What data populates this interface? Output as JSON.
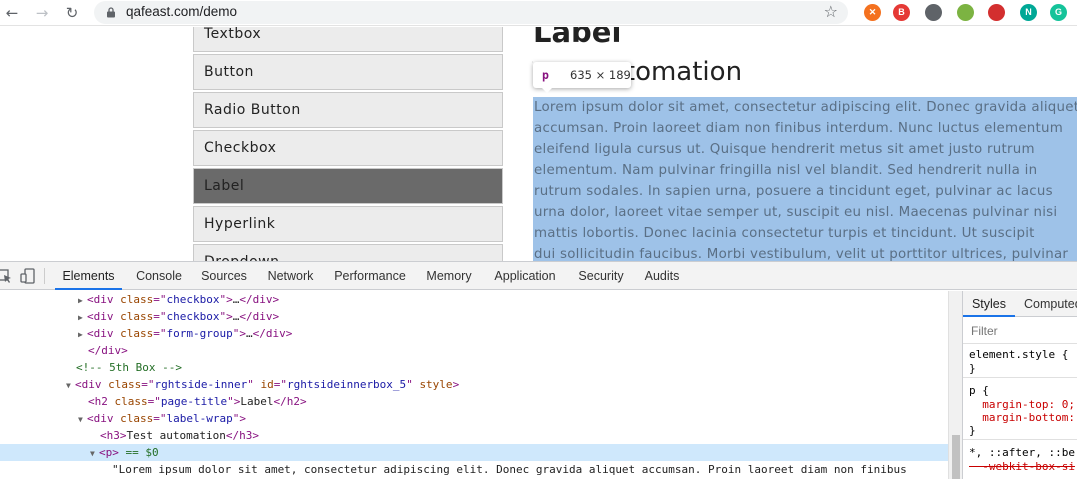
{
  "browser": {
    "url": "qafeast.com/demo",
    "extensions": [
      {
        "name": "orange-extension-icon",
        "glyph": "✕",
        "color": "#f4711f"
      },
      {
        "name": "red-extension-icon",
        "glyph": "B",
        "color": "#e53935"
      },
      {
        "name": "puzzle-extension-icon",
        "glyph": "",
        "color": "#5f6368"
      },
      {
        "name": "robot-extension-icon",
        "glyph": "",
        "color": "#7cb342"
      },
      {
        "name": "colorful-extension-icon",
        "glyph": "",
        "color": "#d32f2f"
      },
      {
        "name": "teal-n-extension-icon",
        "glyph": "N",
        "color": "#00a896"
      },
      {
        "name": "green-g-extension-icon",
        "glyph": "G",
        "color": "#15c39a"
      }
    ]
  },
  "page": {
    "sidebar": [
      {
        "label": "Textbox",
        "active": false
      },
      {
        "label": "Button",
        "active": false
      },
      {
        "label": "Radio Button",
        "active": false
      },
      {
        "label": "Checkbox",
        "active": false
      },
      {
        "label": "Label",
        "active": true
      },
      {
        "label": "Hyperlink",
        "active": false
      },
      {
        "label": "Dropdown",
        "active": false
      }
    ],
    "heading": "Label",
    "subheading": "Test automation",
    "tooltip": {
      "tag": "p",
      "size": "635 × 189"
    },
    "lorem_lines": [
      "Lorem ipsum dolor sit amet, consectetur adipiscing elit. Donec gravida aliquet",
      "accumsan. Proin laoreet diam non finibus interdum. Nunc luctus elementum",
      "eleifend ligula cursus ut. Quisque hendrerit metus sit amet justo rutrum",
      "elementum. Nam pulvinar fringilla nisl vel blandit. Sed hendrerit nulla in",
      "rutrum sodales. In sapien urna, posuere a tincidunt eget, pulvinar ac lacus",
      "urna dolor, laoreet vitae semper ut, suscipit eu nisl. Maecenas pulvinar nisi",
      "mattis lobortis. Donec lacinia consectetur turpis et tincidunt. Ut suscipit",
      "dui sollicitudin faucibus. Morbi vestibulum, velit ut porttitor ultrices, pulvinar"
    ]
  },
  "devtools": {
    "tabs": [
      "Elements",
      "Console",
      "Sources",
      "Network",
      "Performance",
      "Memory",
      "Application",
      "Security",
      "Audits"
    ],
    "active_tab": "Elements",
    "styles_tabs": [
      "Styles",
      "Computed"
    ],
    "filter_placeholder": "Filter",
    "dom": [
      {
        "indent": 88,
        "tri": "▶",
        "parts": [
          [
            "tag",
            "<div "
          ],
          [
            "attr",
            "class"
          ],
          [
            "tag",
            "=\""
          ],
          [
            "val",
            "checkbox"
          ],
          [
            "tag",
            "\">"
          ],
          [
            "txt",
            "…"
          ],
          [
            "tag",
            "</div>"
          ]
        ]
      },
      {
        "indent": 88,
        "tri": "▶",
        "parts": [
          [
            "tag",
            "<div "
          ],
          [
            "attr",
            "class"
          ],
          [
            "tag",
            "=\""
          ],
          [
            "val",
            "checkbox"
          ],
          [
            "tag",
            "\">"
          ],
          [
            "txt",
            "…"
          ],
          [
            "tag",
            "</div>"
          ]
        ]
      },
      {
        "indent": 88,
        "tri": "▶",
        "parts": [
          [
            "tag",
            "<div "
          ],
          [
            "attr",
            "class"
          ],
          [
            "tag",
            "=\""
          ],
          [
            "val",
            "form-group"
          ],
          [
            "tag",
            "\">"
          ],
          [
            "txt",
            "…"
          ],
          [
            "tag",
            "</div>"
          ]
        ]
      },
      {
        "indent": 88,
        "tri": "",
        "parts": [
          [
            "tag",
            "</div>"
          ]
        ]
      },
      {
        "indent": 76,
        "tri": "",
        "parts": [
          [
            "cmt",
            "<!-- 5th Box -->"
          ]
        ]
      },
      {
        "indent": 76,
        "tri": "▼",
        "parts": [
          [
            "tag",
            "<div "
          ],
          [
            "attr",
            "class"
          ],
          [
            "tag",
            "=\""
          ],
          [
            "val",
            "rghtside-inner"
          ],
          [
            "tag",
            "\" "
          ],
          [
            "attr",
            "id"
          ],
          [
            "tag",
            "=\""
          ],
          [
            "val",
            "rghtsideinnerbox_5"
          ],
          [
            "tag",
            "\" "
          ],
          [
            "attr",
            "style"
          ],
          [
            "tag",
            ">"
          ]
        ]
      },
      {
        "indent": 88,
        "tri": "",
        "parts": [
          [
            "tag",
            "<h2 "
          ],
          [
            "attr",
            "class"
          ],
          [
            "tag",
            "=\""
          ],
          [
            "val",
            "page-title"
          ],
          [
            "tag",
            "\">"
          ],
          [
            "txt",
            "Label"
          ],
          [
            "tag",
            "</h2>"
          ]
        ]
      },
      {
        "indent": 88,
        "tri": "▼",
        "parts": [
          [
            "tag",
            "<div "
          ],
          [
            "attr",
            "class"
          ],
          [
            "tag",
            "=\""
          ],
          [
            "val",
            "label-wrap"
          ],
          [
            "tag",
            "\">"
          ]
        ]
      },
      {
        "indent": 100,
        "tri": "",
        "parts": [
          [
            "tag",
            "<h3>"
          ],
          [
            "txt",
            "Test automation"
          ],
          [
            "tag",
            "</h3>"
          ]
        ]
      },
      {
        "indent": 100,
        "tri": "▼",
        "selected": true,
        "parts": [
          [
            "tag",
            "<p>"
          ],
          [
            "cmt",
            " == $0"
          ]
        ]
      },
      {
        "indent": 112,
        "tri": "",
        "parts": [
          [
            "txt",
            "\"Lorem ipsum dolor sit amet, consectetur adipiscing elit. Donec gravida aliquet accumsan. Proin laoreet diam non finibus"
          ]
        ]
      }
    ],
    "css": [
      {
        "text": "element.style {",
        "cls": ""
      },
      {
        "text": "}",
        "cls": ""
      },
      {
        "text": "p {",
        "cls": ""
      },
      {
        "text": "  margin-top: 0;",
        "cls": "css-prop"
      },
      {
        "text": "  margin-bottom:",
        "cls": "css-prop"
      },
      {
        "text": "}",
        "cls": ""
      },
      {
        "text": "*, ::after, ::be",
        "cls": ""
      },
      {
        "text": "  -webkit-box-si",
        "cls": "css-strike"
      }
    ]
  }
}
